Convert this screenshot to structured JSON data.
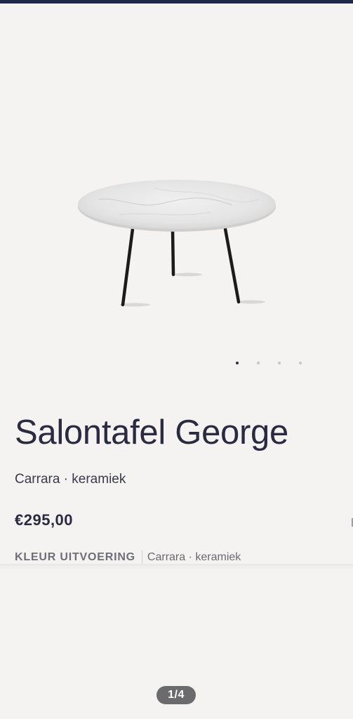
{
  "product": {
    "title": "Salontafel George",
    "subtitle": "Carrara · keramiek",
    "price": "€295,00",
    "variant": {
      "label": "KLEUR UITVOERING",
      "value": "Carrara · keramiek"
    },
    "image_icon": "table-image"
  },
  "gallery": {
    "dot_count": 4,
    "active_index": 0,
    "pager": "1/4"
  },
  "colors": {
    "top_bar": "#1f2a4a",
    "background": "#f4f3f1",
    "title_text": "#2a2a40",
    "pager_bg": "#6b6b6e"
  }
}
